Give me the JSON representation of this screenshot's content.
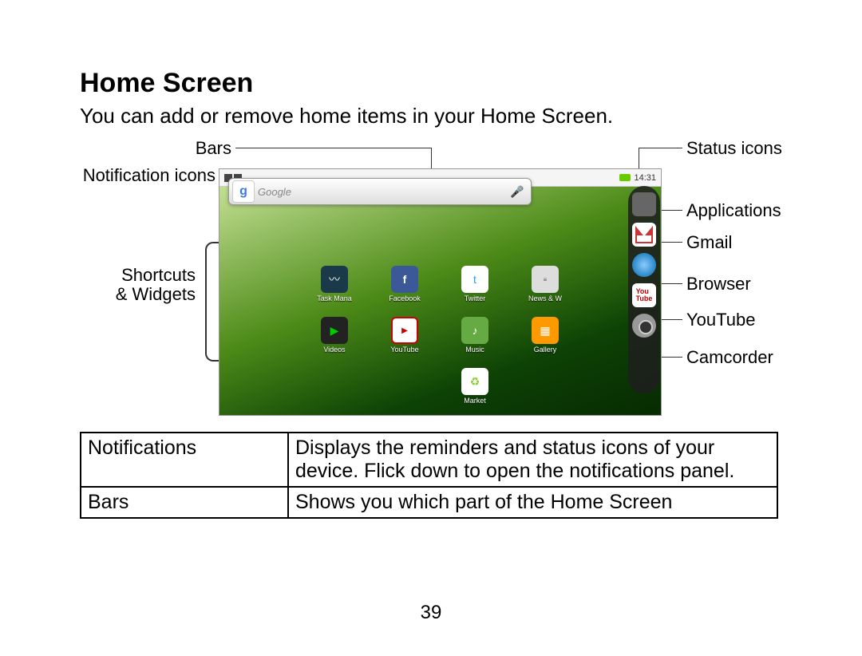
{
  "title": "Home Screen",
  "intro": "You can add or remove home items in your Home Screen.",
  "labels": {
    "bars": "Bars",
    "notification_icons": "Notification icons",
    "shortcuts_widgets": "Shortcuts\n& Widgets",
    "status_icons": "Status icons",
    "applications": "Applications",
    "gmail": "Gmail",
    "browser": "Browser",
    "youtube": "YouTube",
    "camcorder": "Camcorder"
  },
  "screenshot": {
    "time": "14:31",
    "search_placeholder": "Google",
    "apps": {
      "task_manager": "Task Mana",
      "facebook": "Facebook",
      "twitter": "Twitter",
      "news": "News & W",
      "videos": "Videos",
      "youtube": "YouTube",
      "music": "Music",
      "gallery": "Gallery",
      "market": "Market"
    },
    "dock_yt": "You\nTube"
  },
  "table": {
    "rows": [
      {
        "c1": "Notifications",
        "c2": "Displays the reminders and status icons of your device. Flick down to open the notifications panel."
      },
      {
        "c1": "Bars",
        "c2": "Shows you which part of the Home Screen"
      }
    ]
  },
  "page_number": "39"
}
